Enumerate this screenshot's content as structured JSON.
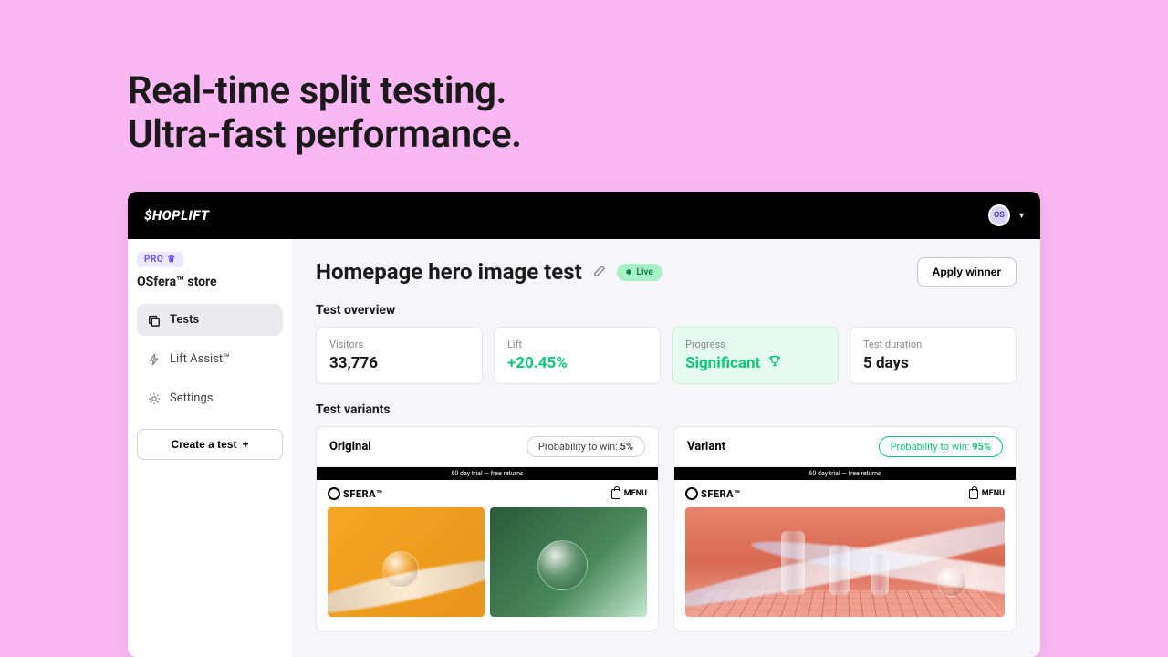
{
  "hero": {
    "line1": "Real-time split testing.",
    "line2": "Ultra-fast performance."
  },
  "header": {
    "brand": "$HOPLIFT",
    "avatar_initials": "OS"
  },
  "sidebar": {
    "pro_badge": "PRO",
    "store": "OSfera™ store",
    "items": [
      {
        "label": "Tests",
        "icon": "layers"
      },
      {
        "label": "Lift Assist™",
        "icon": "bolt"
      },
      {
        "label": "Settings",
        "icon": "gear"
      }
    ],
    "create_label": "Create a test"
  },
  "page": {
    "title": "Homepage hero image test",
    "status": "Live",
    "apply_btn": "Apply winner",
    "overview_label": "Test overview",
    "variants_label": "Test variants"
  },
  "stats": [
    {
      "label": "Visitors",
      "value": "33,776",
      "kind": "plain"
    },
    {
      "label": "Lift",
      "value": "+20.45%",
      "kind": "green"
    },
    {
      "label": "Progress",
      "value": "Significant",
      "kind": "green-highlight",
      "trophy": true
    },
    {
      "label": "Test duration",
      "value": "5 days",
      "kind": "plain"
    }
  ],
  "variants": [
    {
      "name": "Original",
      "prob_label": "Probability to win:",
      "prob_value": "5%",
      "win": false
    },
    {
      "name": "Variant",
      "prob_label": "Probability to win:",
      "prob_value": "95%",
      "win": true
    }
  ],
  "preview": {
    "promo": "60 day trial — free returns",
    "brand": "SFERA™",
    "menu": "MENU"
  }
}
